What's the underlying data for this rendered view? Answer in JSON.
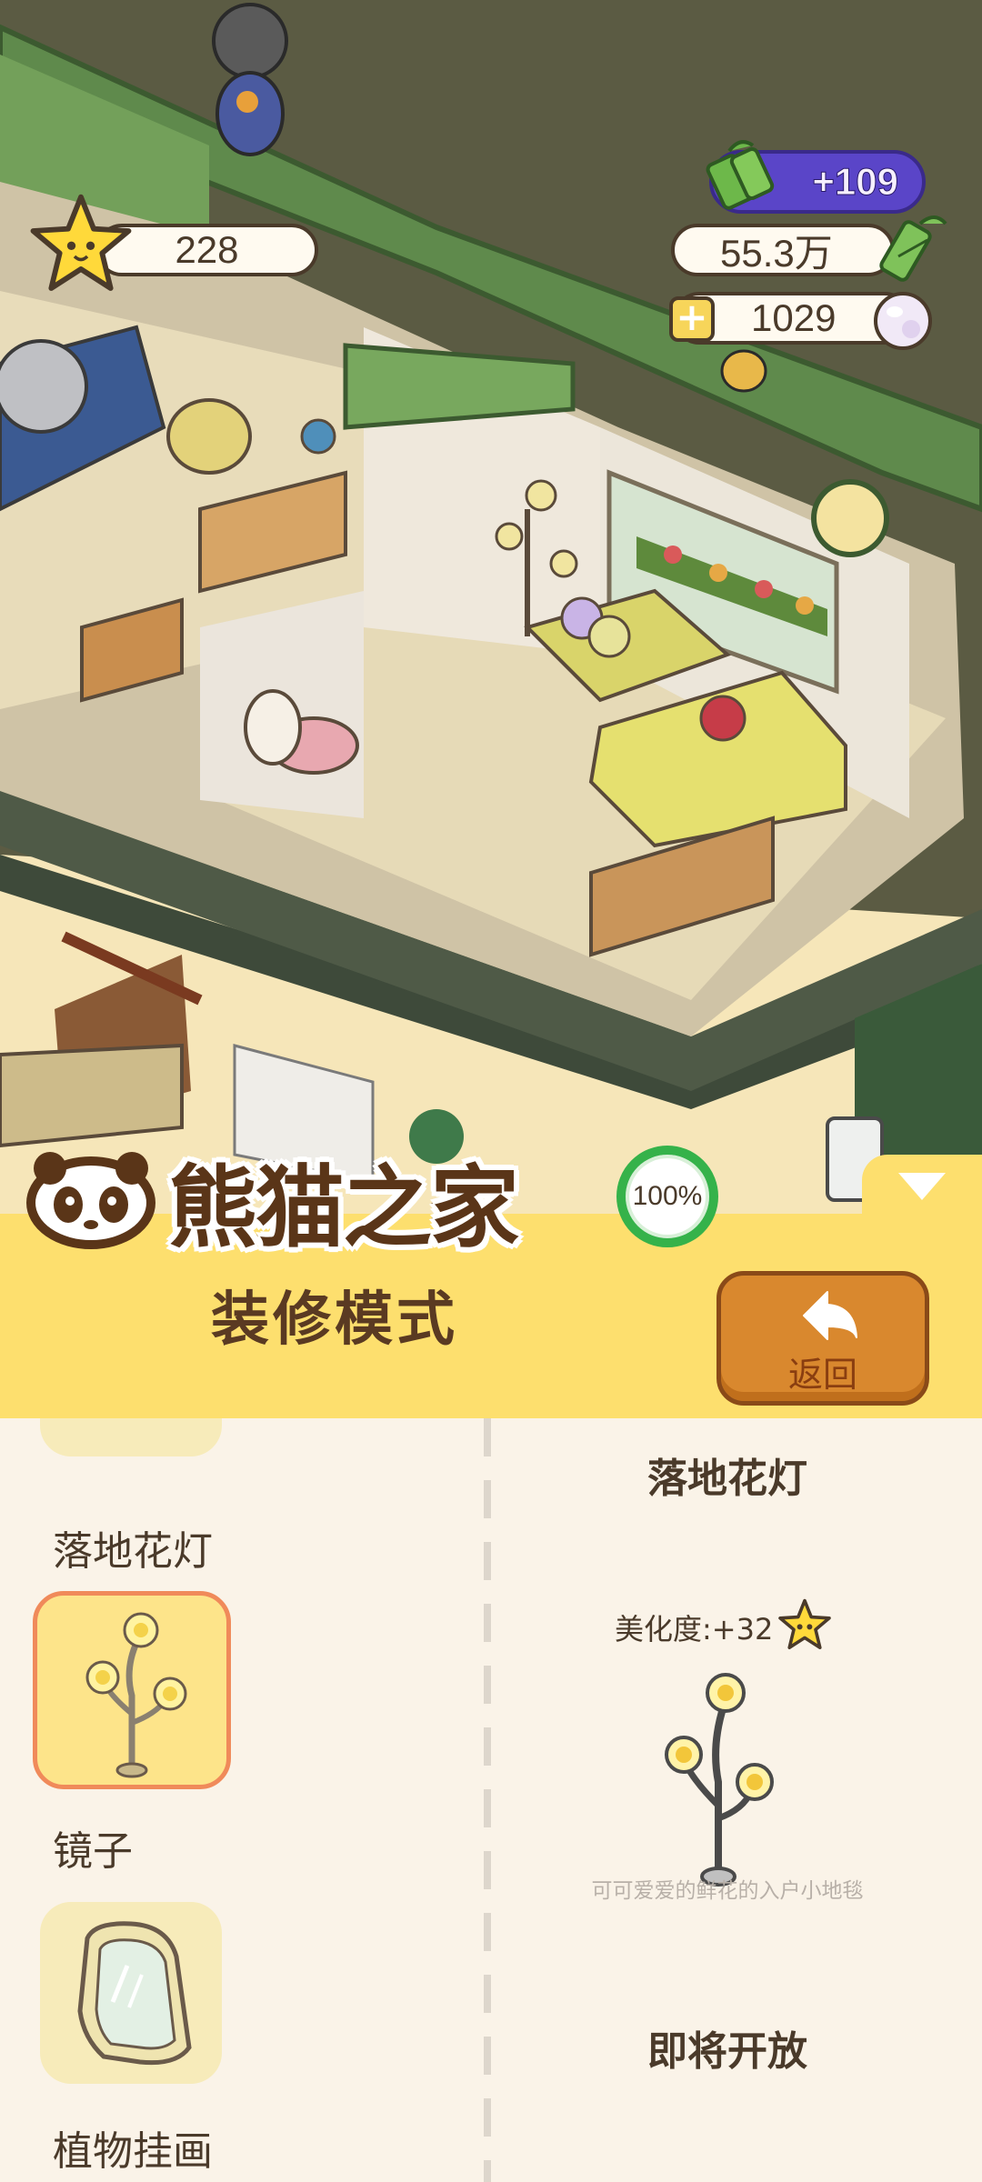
{
  "game_title": "熊猫之家",
  "progress_text": "100%",
  "hud": {
    "stars": "228",
    "bamboo_bonus": "+109",
    "bamboo": "55.3万",
    "pearls": "1029"
  },
  "mode_title": "装修模式",
  "back_button_label": "返回",
  "item_list": [
    {
      "label": "落地花灯",
      "selected": true
    },
    {
      "label": "镜子",
      "selected": false
    },
    {
      "label": "植物挂画",
      "selected": false
    }
  ],
  "detail": {
    "name": "落地花灯",
    "beauty_label": "美化度:+32",
    "description": "可可爱爱的鲜花的入户小地毯",
    "status": "即将开放"
  },
  "colors": {
    "banner": "#fddf6e",
    "panel": "#faf3e8",
    "back_button": "#d9882e",
    "progress_ring": "#35b24a",
    "bonus_pill": "#5a45c8",
    "selected_border": "#f08a5a"
  },
  "icons": [
    "star-icon",
    "bamboo-icon",
    "pearl-icon",
    "plus-icon",
    "panda-logo-icon",
    "back-arrow-icon",
    "collapse-arrow-icon",
    "floor-lamp-icon",
    "mirror-icon"
  ]
}
